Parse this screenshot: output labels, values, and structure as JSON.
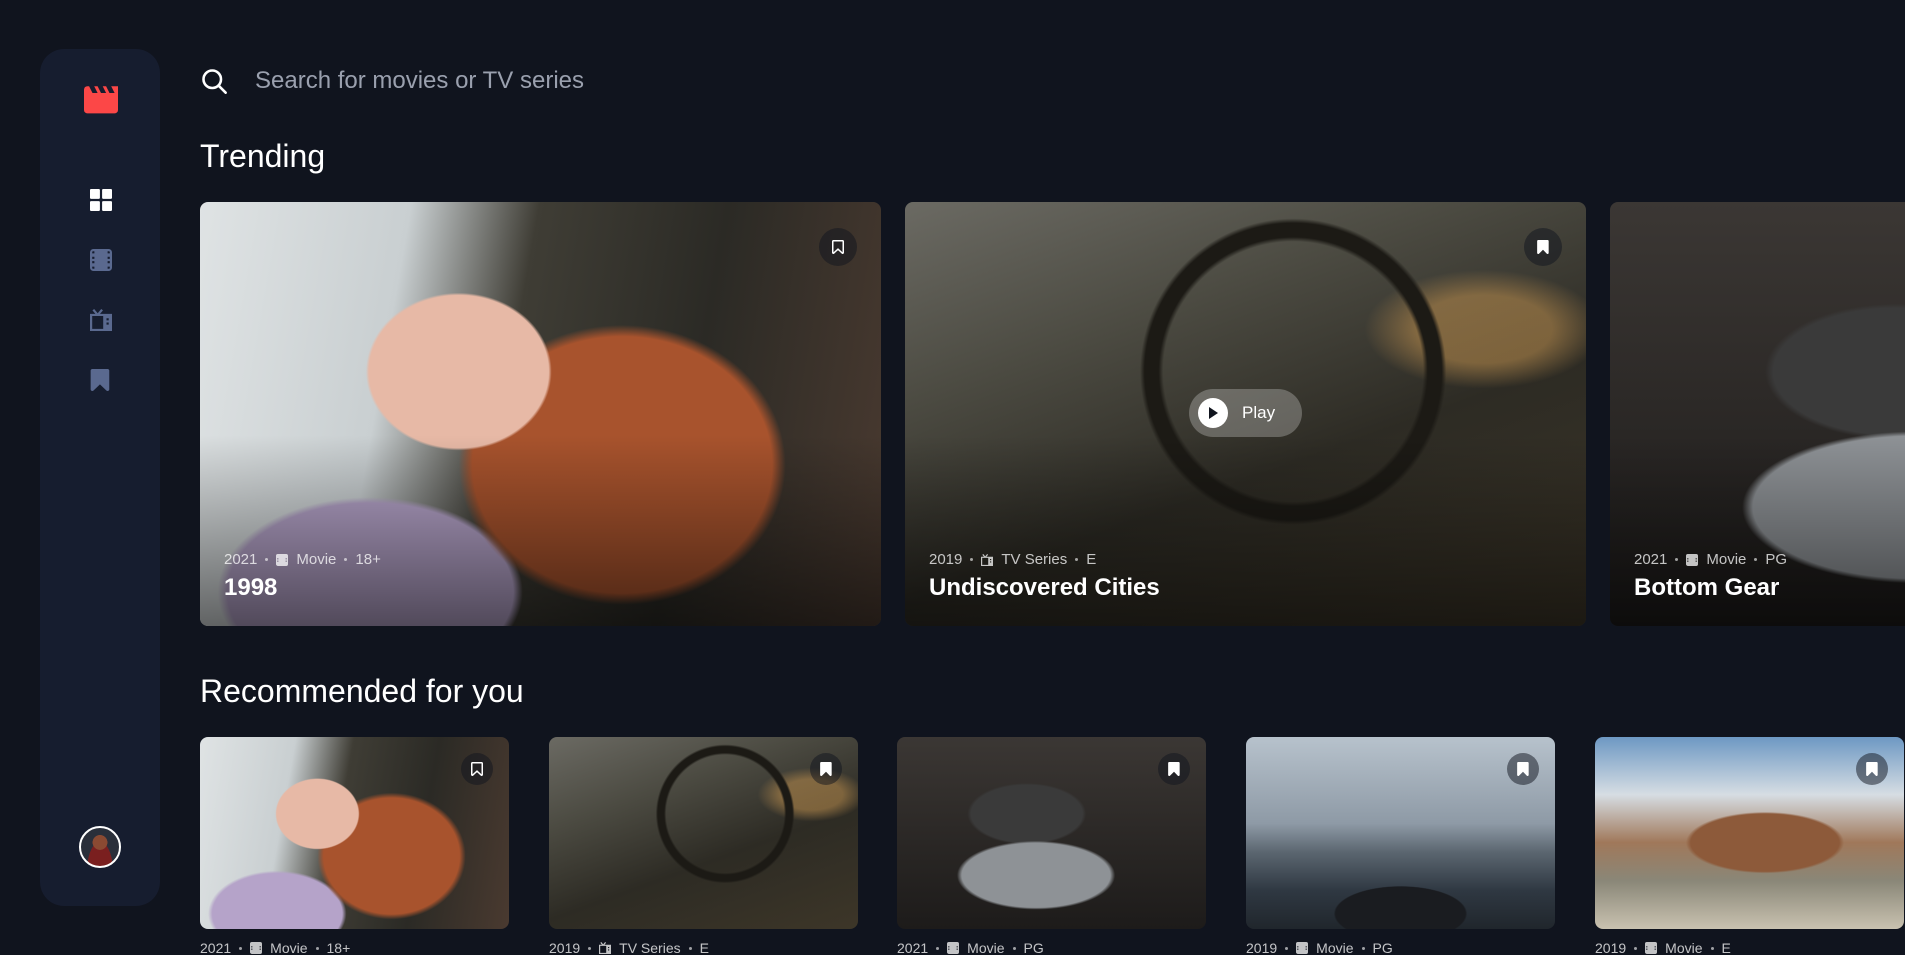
{
  "search": {
    "placeholder": "Search for movies or TV series"
  },
  "nav": {
    "items": [
      {
        "icon": "grid-icon",
        "active": true
      },
      {
        "icon": "film-icon",
        "active": false
      },
      {
        "icon": "tv-icon",
        "active": false
      },
      {
        "icon": "bookmark-icon",
        "active": false
      }
    ]
  },
  "sections": {
    "trending_title": "Trending",
    "recommended_title": "Recommended for you"
  },
  "trending": [
    {
      "year": "2021",
      "category": "Movie",
      "rating": "18+",
      "title": "1998",
      "bookmarked": false
    },
    {
      "year": "2019",
      "category": "TV Series",
      "rating": "E",
      "title": "Undiscovered Cities",
      "bookmarked": true,
      "play_label": "Play"
    },
    {
      "year": "2021",
      "category": "Movie",
      "rating": "PG",
      "title": "Bottom Gear",
      "bookmarked": false
    }
  ],
  "recommended": [
    {
      "year": "2021",
      "category": "Movie",
      "rating": "18+",
      "bookmarked": false
    },
    {
      "year": "2019",
      "category": "TV Series",
      "rating": "E",
      "bookmarked": true
    },
    {
      "year": "2021",
      "category": "Movie",
      "rating": "PG",
      "bookmarked": true
    },
    {
      "year": "2019",
      "category": "Movie",
      "rating": "PG",
      "bookmarked": true
    },
    {
      "year": "2019",
      "category": "Movie",
      "rating": "E",
      "bookmarked": true
    }
  ],
  "colors": {
    "background": "#10141E",
    "sidebar": "#161D2F",
    "accent": "#FC4747",
    "nav_inactive": "#5A698F"
  }
}
